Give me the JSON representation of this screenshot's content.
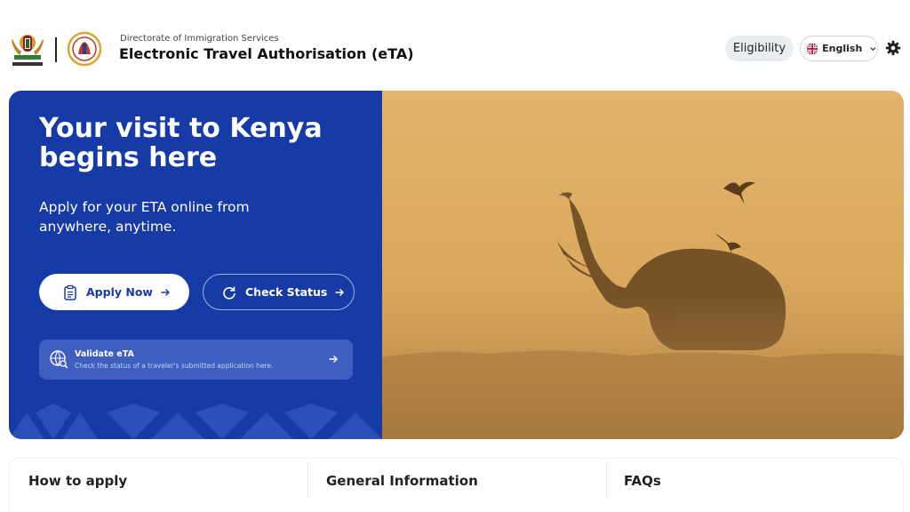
{
  "header": {
    "directorate": "Directorate of Immigration Services",
    "title": "Electronic Travel Authorisation (eTA)",
    "eligibility_label": "Eligibility",
    "language_label": "English",
    "icons": [
      "coat-of-arms-logo",
      "immigration-seal-logo",
      "uk-flag-icon",
      "chevron-down-icon",
      "gear-icon"
    ]
  },
  "hero": {
    "title": "Your visit to Kenya begins here",
    "subtitle": "Apply for your ETA online from anywhere, anytime.",
    "apply_label": "Apply Now",
    "status_label": "Check Status",
    "validate_title": "Validate eTA",
    "validate_desc": "Check the status of a traveler's submitted application here.",
    "colors": {
      "panel": "#163ba6",
      "photo_tone": "#d4a45d"
    }
  },
  "cards": [
    {
      "label": "How to apply"
    },
    {
      "label": "General Information"
    },
    {
      "label": "FAQs"
    }
  ]
}
